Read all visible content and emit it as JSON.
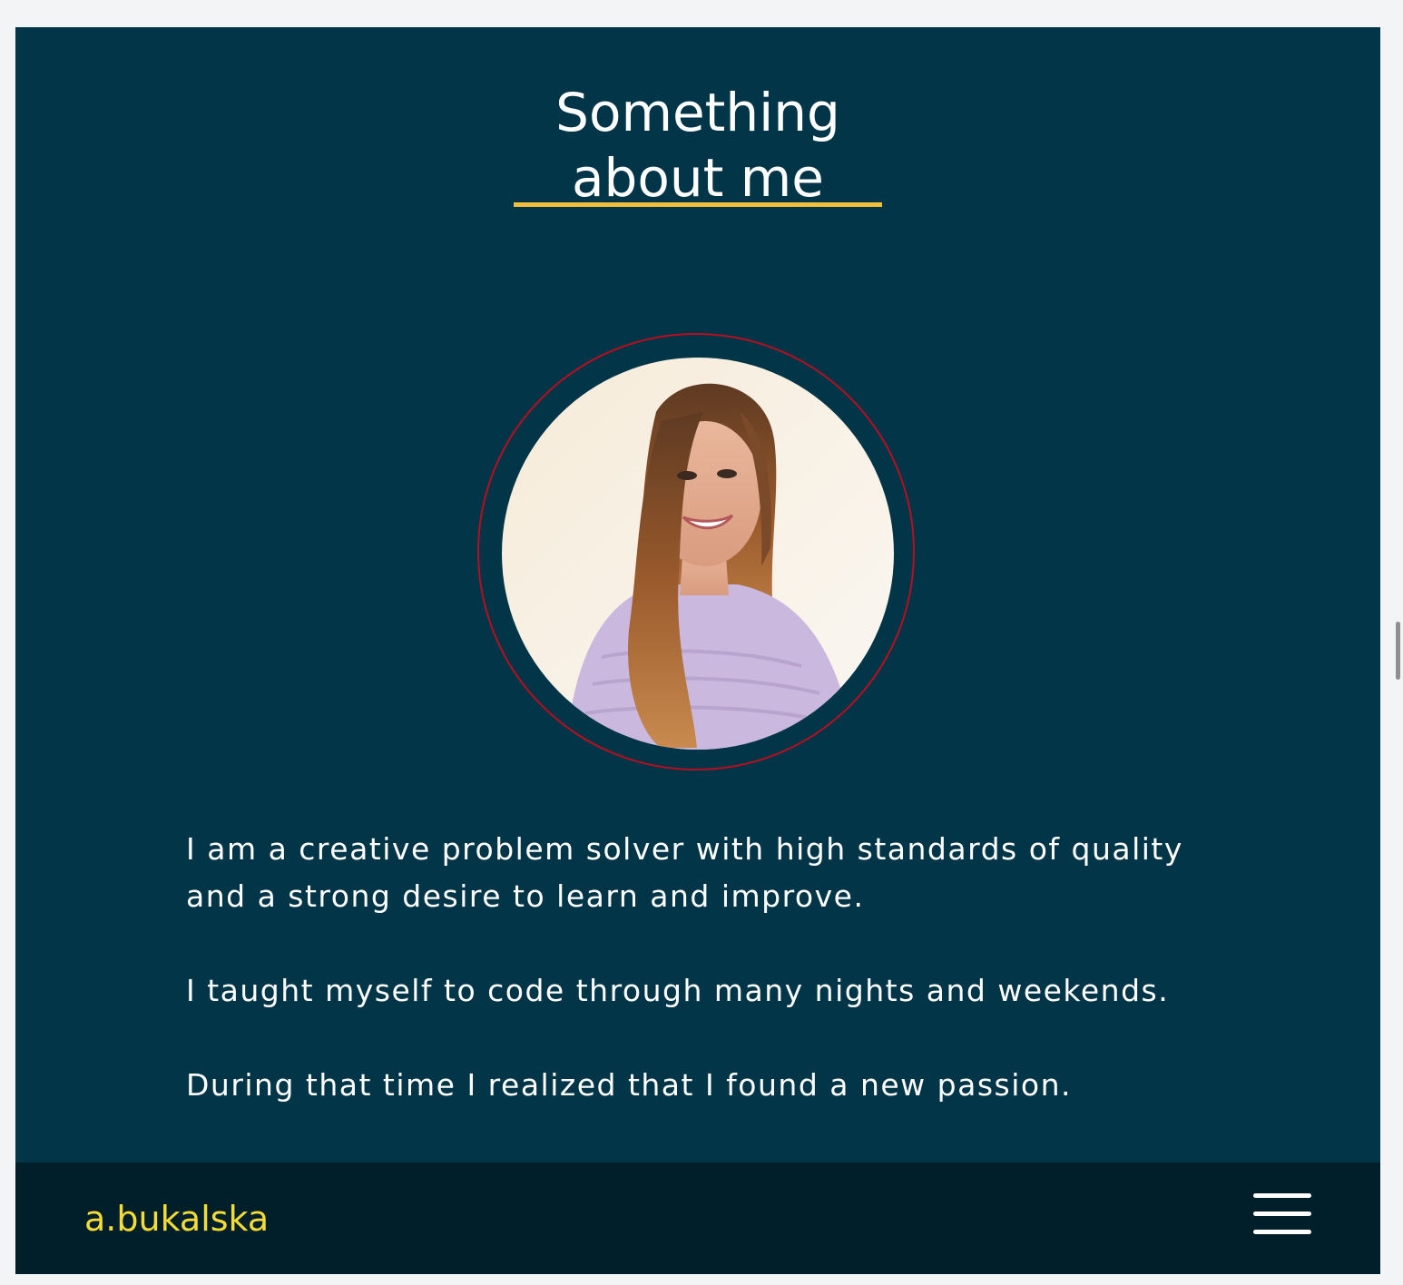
{
  "about": {
    "heading_line1": "Something",
    "heading_line2": "about me"
  },
  "bio": {
    "paragraph1": "I am a creative problem solver with high standards of quality and a strong desire to learn and improve.",
    "paragraph2": "I taught myself to code through many nights and weekends.",
    "paragraph3": "During that time I realized that I found a new passion."
  },
  "footer": {
    "brand": "a.bukalska",
    "menu_icon": "hamburger-menu-icon"
  },
  "colors": {
    "background": "#013547",
    "footer": "#011f2b",
    "accent_underline": "#f2bf3c",
    "brand": "#f5dc35",
    "ring": "#b80e1f",
    "text": "#ffffff"
  }
}
